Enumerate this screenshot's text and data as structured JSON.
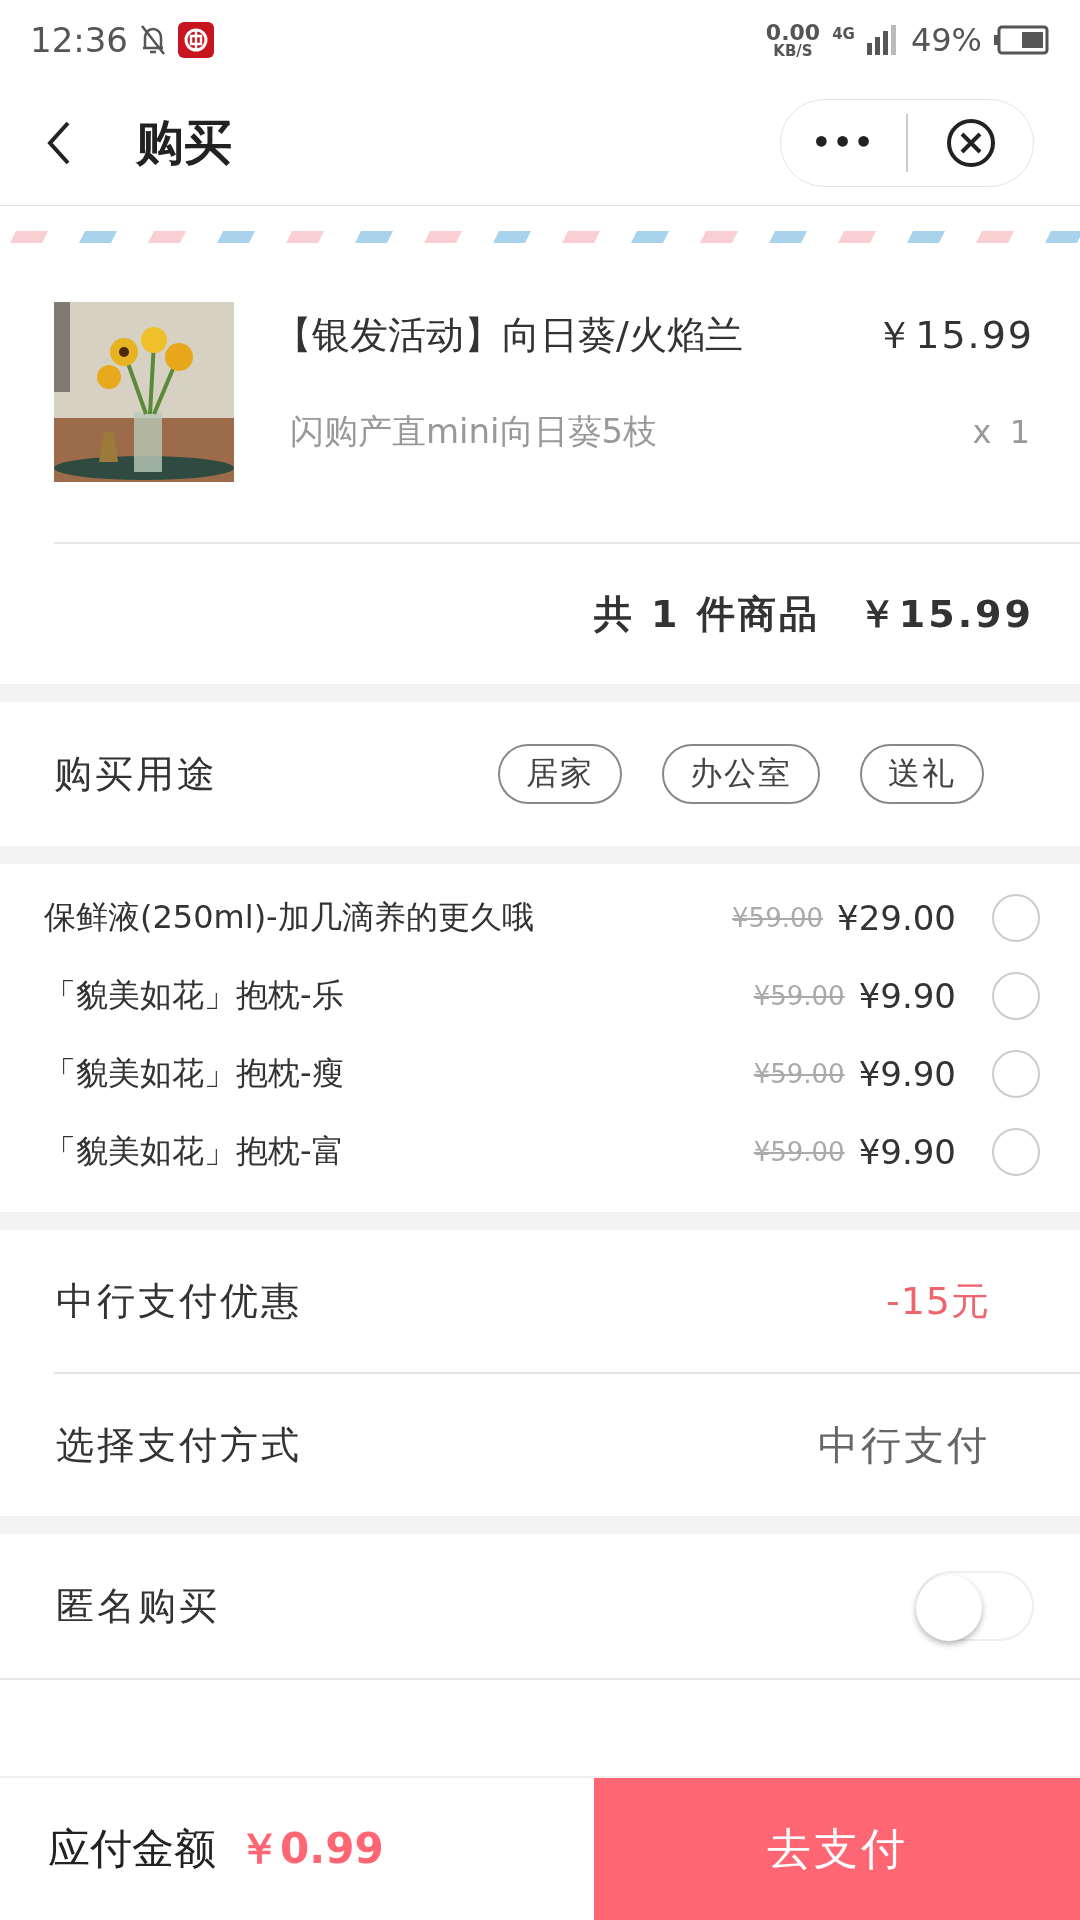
{
  "status_bar": {
    "time": "12:36",
    "speed_value": "0.00",
    "speed_unit": "KB/S",
    "network": "4G",
    "battery": "49%"
  },
  "nav": {
    "title": "购买",
    "more": "•••"
  },
  "product": {
    "title": "【银发活动】向日葵/火焰兰",
    "price": "￥15.99",
    "subtitle": "闪购产直mini向日葵5枝",
    "quantity": "x 1"
  },
  "summary": {
    "text": "共 1 件商品",
    "total": "￥15.99"
  },
  "purpose": {
    "label": "购买用途",
    "options": [
      {
        "label": "居家",
        "selected": false
      },
      {
        "label": "办公室",
        "selected": false
      },
      {
        "label": "送礼",
        "selected": false
      }
    ]
  },
  "addons": [
    {
      "name": "保鲜液(250ml)-加几滴养的更久哦",
      "old_price": "¥59.00",
      "price": "¥29.00",
      "selected": false
    },
    {
      "name": "「貌美如花」抱枕-乐",
      "old_price": "¥59.00",
      "price": "¥9.90",
      "selected": false
    },
    {
      "name": "「貌美如花」抱枕-瘦",
      "old_price": "¥59.00",
      "price": "¥9.90",
      "selected": false
    },
    {
      "name": "「貌美如花」抱枕-富",
      "old_price": "¥59.00",
      "price": "¥9.90",
      "selected": false
    }
  ],
  "discount": {
    "label": "中行支付优惠",
    "value": "-15元"
  },
  "payment": {
    "label": "选择支付方式",
    "value": "中行支付"
  },
  "anonymous": {
    "label": "匿名购买",
    "on": false
  },
  "bottom_bar": {
    "label": "应付金额",
    "amount": "￥0.99",
    "button": "去支付"
  }
}
